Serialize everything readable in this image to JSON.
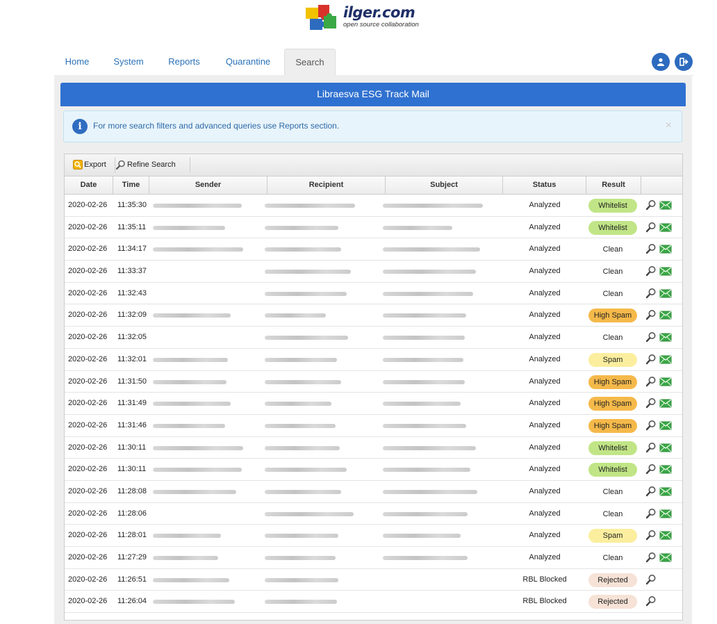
{
  "logo": {
    "name": "ilger.com",
    "tagline": "open source collaboration"
  },
  "nav": {
    "tabs": [
      "Home",
      "System",
      "Reports",
      "Quarantine",
      "Search"
    ],
    "active": "Search"
  },
  "panel": {
    "title": "Libraesva ESG Track Mail",
    "info": "For more search filters and advanced queries use Reports section.",
    "close": "×"
  },
  "toolbar": {
    "export_label": "Export",
    "refine_label": "Refine Search"
  },
  "columns": [
    "Date",
    "Time",
    "Sender",
    "Recipient",
    "Subject",
    "Status",
    "Result",
    ""
  ],
  "colors": {
    "accent": "#2f71d0",
    "whitelist": "#c1e586",
    "high_spam": "#f5b94a",
    "spam": "#fbee9e",
    "rejected": "#f6e2d6"
  },
  "rows": [
    {
      "date": "2020-02-26",
      "time": "11:35:30",
      "status": "Analyzed",
      "result": "Whitelist",
      "sender": true,
      "mail": true
    },
    {
      "date": "2020-02-26",
      "time": "11:35:11",
      "status": "Analyzed",
      "result": "Whitelist",
      "sender": true,
      "mail": true
    },
    {
      "date": "2020-02-26",
      "time": "11:34:17",
      "status": "Analyzed",
      "result": "Clean",
      "sender": true,
      "mail": true
    },
    {
      "date": "2020-02-26",
      "time": "11:33:37",
      "status": "Analyzed",
      "result": "Clean",
      "sender": false,
      "mail": true
    },
    {
      "date": "2020-02-26",
      "time": "11:32:43",
      "status": "Analyzed",
      "result": "Clean",
      "sender": false,
      "mail": true
    },
    {
      "date": "2020-02-26",
      "time": "11:32:09",
      "status": "Analyzed",
      "result": "High Spam",
      "sender": true,
      "mail": true
    },
    {
      "date": "2020-02-26",
      "time": "11:32:05",
      "status": "Analyzed",
      "result": "Clean",
      "sender": false,
      "mail": true
    },
    {
      "date": "2020-02-26",
      "time": "11:32:01",
      "status": "Analyzed",
      "result": "Spam",
      "sender": true,
      "mail": true
    },
    {
      "date": "2020-02-26",
      "time": "11:31:50",
      "status": "Analyzed",
      "result": "High Spam",
      "sender": true,
      "mail": true
    },
    {
      "date": "2020-02-26",
      "time": "11:31:49",
      "status": "Analyzed",
      "result": "High Spam",
      "sender": true,
      "mail": true
    },
    {
      "date": "2020-02-26",
      "time": "11:31:46",
      "status": "Analyzed",
      "result": "High Spam",
      "sender": true,
      "mail": true
    },
    {
      "date": "2020-02-26",
      "time": "11:30:11",
      "status": "Analyzed",
      "result": "Whitelist",
      "sender": true,
      "mail": true
    },
    {
      "date": "2020-02-26",
      "time": "11:30:11",
      "status": "Analyzed",
      "result": "Whitelist",
      "sender": true,
      "mail": true
    },
    {
      "date": "2020-02-26",
      "time": "11:28:08",
      "status": "Analyzed",
      "result": "Clean",
      "sender": true,
      "mail": true
    },
    {
      "date": "2020-02-26",
      "time": "11:28:06",
      "status": "Analyzed",
      "result": "Clean",
      "sender": false,
      "mail": true
    },
    {
      "date": "2020-02-26",
      "time": "11:28:01",
      "status": "Analyzed",
      "result": "Spam",
      "sender": true,
      "mail": true
    },
    {
      "date": "2020-02-26",
      "time": "11:27:29",
      "status": "Analyzed",
      "result": "Clean",
      "sender": true,
      "mail": true
    },
    {
      "date": "2020-02-26",
      "time": "11:26:51",
      "status": "RBL Blocked",
      "result": "Rejected",
      "sender": true,
      "mail": false
    },
    {
      "date": "2020-02-26",
      "time": "11:26:04",
      "status": "RBL Blocked",
      "result": "Rejected",
      "sender": true,
      "mail": false
    }
  ]
}
